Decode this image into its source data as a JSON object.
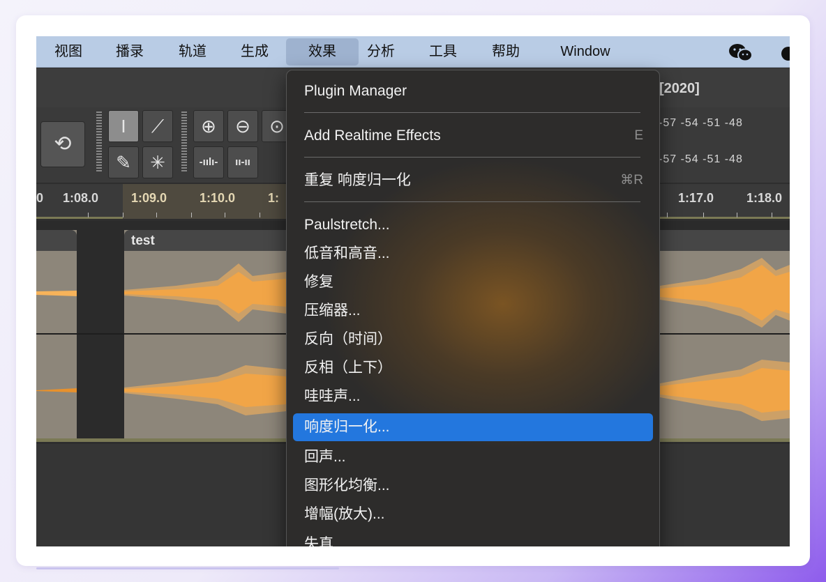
{
  "menubar": {
    "items": [
      "视图",
      "播录",
      "轨道",
      "生成",
      "效果",
      "分析",
      "工具",
      "帮助",
      "Window"
    ],
    "active": "效果",
    "tray": [
      "wechat-icon",
      "cloud-icon"
    ]
  },
  "window": {
    "title_fragment": "[2020]"
  },
  "toolbar": {
    "tools": [
      "select-tool-icon",
      "envelope-tool-icon",
      "draw-tool-icon",
      "multi-tool-icon"
    ],
    "zoom": [
      "zoom-in-icon",
      "zoom-out-icon",
      "zoom-fit-icon"
    ],
    "trim": [
      "trim-outside-icon",
      "silence-selection-icon"
    ],
    "meter_scale_top": "-57  -54  -51  -48",
    "meter_scale_bottom": "-57  -54  -51  -48"
  },
  "ruler": {
    "left_labels": [
      "0",
      "1:08.0",
      "1:09.0",
      "1:10.0",
      "1:"
    ],
    "right_labels": [
      "1:17.0",
      "1:18.0"
    ]
  },
  "track": {
    "clip_name": "test"
  },
  "effects_menu": {
    "plugin_manager": "Plugin Manager",
    "add_realtime": {
      "label": "Add Realtime Effects",
      "shortcut": "E"
    },
    "repeat_last": {
      "label": "重复 响度归一化",
      "shortcut": "⌘R"
    },
    "effects": [
      "Paulstretch...",
      "低音和高音...",
      "修复",
      "压缩器...",
      "反向（时间）",
      "反相（上下）",
      "哇哇声...",
      "响度归一化...",
      "回声...",
      "图形化均衡...",
      "增幅(放大)...",
      "失真"
    ],
    "highlighted": "响度归一化..."
  },
  "colors": {
    "menubar_bg": "#b9cce5",
    "highlight": "#2377de",
    "waveform": "#f7a33a",
    "clip_bg": "#8d867a"
  }
}
